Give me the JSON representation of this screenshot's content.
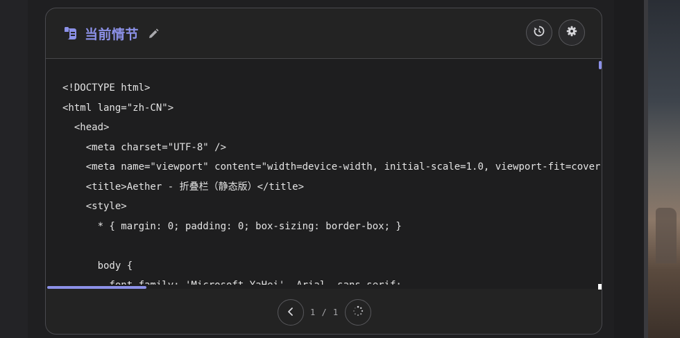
{
  "card": {
    "title": "当前情节",
    "title_color": "#8c91e8",
    "icons": {
      "title": "scroll-icon",
      "edit": "pencil-icon",
      "history": "history-icon",
      "settings": "gear-icon",
      "prev": "chevron-left-icon",
      "loading": "spinner-icon"
    }
  },
  "code_lines": [
    "<!DOCTYPE html>",
    "<html lang=\"zh-CN\">",
    "  <head>",
    "    <meta charset=\"UTF-8\" />",
    "    <meta name=\"viewport\" content=\"width=device-width, initial-scale=1.0, viewport-fit=cover\" />",
    "    <title>Aether - 折叠栏（静态版）</title>",
    "    <style>",
    "      * { margin: 0; padding: 0; box-sizing: border-box; }",
    "",
    "      body {",
    "        font-family: 'Microsoft YaHei', Arial, sans-serif;"
  ],
  "pagination": {
    "current": "1",
    "separator": "/",
    "total": "1",
    "label": "1 / 1"
  }
}
